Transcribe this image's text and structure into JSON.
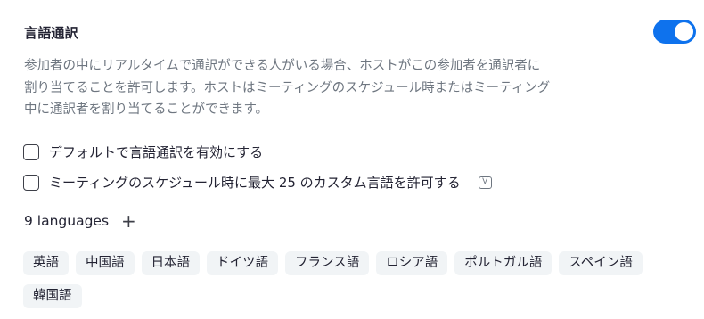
{
  "interpretation": {
    "title": "言語通訳",
    "enabled": true,
    "description_lines": [
      "参加者の中にリアルタイムで通訳ができる人がいる場合、ホストがこの参加者を通訳者に",
      "割り当てることを許可します。ホストはミーティングのスケジュール時またはミーティング",
      "中に通訳者を割り当てることができます。"
    ],
    "options": [
      {
        "label": "デフォルトで言語通訳を有効にする",
        "checked": false
      },
      {
        "label": "ミーティングのスケジュール時に最大 25 のカスタム言語を許可する",
        "checked": false,
        "badge": "V"
      }
    ],
    "languages_count_label": "9 languages",
    "add_symbol": "+",
    "languages": [
      "英語",
      "中国語",
      "日本語",
      "ドイツ語",
      "フランス語",
      "ロシア語",
      "ポルトガル語",
      "スペイン語",
      "韓国語"
    ],
    "accent_color": "#0e72ed"
  }
}
